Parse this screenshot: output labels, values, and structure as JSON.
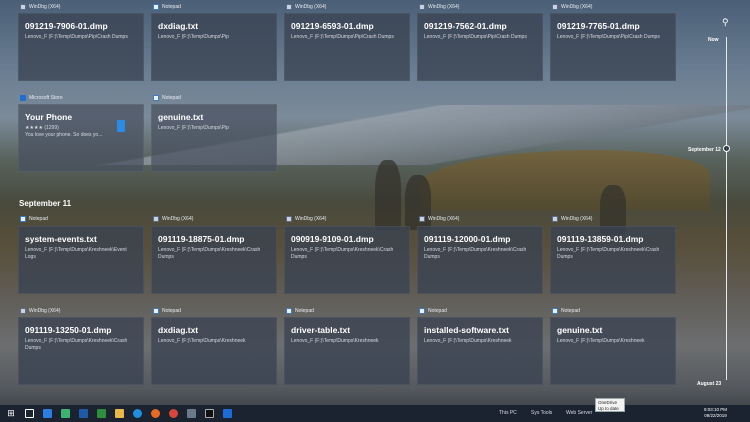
{
  "row1": [
    {
      "app": "WinDbg (X64)",
      "icon": "windbg-icon",
      "title": "091219-7906-01.dmp",
      "path": "Lenovo_F (F:)\\Temp\\Dumps\\Pip\\Crash Dumps"
    },
    {
      "app": "Notepad",
      "icon": "notepad-icon",
      "title": "dxdiag.txt",
      "path": "Lenovo_F (F:)\\Temp\\Dumps\\Pip"
    },
    {
      "app": "WinDbg (X64)",
      "icon": "windbg-icon",
      "title": "091219-6593-01.dmp",
      "path": "Lenovo_F (F:)\\Temp\\Dumps\\Pip\\Crash Dumps"
    },
    {
      "app": "WinDbg (X64)",
      "icon": "windbg-icon",
      "title": "091219-7562-01.dmp",
      "path": "Lenovo_F (F:)\\Temp\\Dumps\\Pip\\Crash Dumps"
    },
    {
      "app": "WinDbg (X64)",
      "icon": "windbg-icon",
      "title": "091219-7765-01.dmp",
      "path": "Lenovo_F (F:)\\Temp\\Dumps\\Pip\\Crash Dumps"
    }
  ],
  "row2": [
    {
      "app": "Microsoft Store",
      "icon": "store-icon",
      "title": "Your Phone",
      "path": "★★★★ (1299)\nYou love your phone. So does yo..."
    },
    {
      "app": "Notepad",
      "icon": "notepad-icon",
      "title": "genuine.txt",
      "path": "Lenovo_F (F:)\\Temp\\Dumps\\Pip"
    }
  ],
  "section_label": "September 11",
  "row3": [
    {
      "app": "Notepad",
      "icon": "notepad-icon",
      "title": "system-events.txt",
      "path": "Lenovo_F (F:)\\Temp\\Dumps\\Kreshneek\\Event Logs"
    },
    {
      "app": "WinDbg (X64)",
      "icon": "windbg-icon",
      "title": "091119-18875-01.dmp",
      "path": "Lenovo_F (F:)\\Temp\\Dumps\\Kreshneek\\Crash Dumps"
    },
    {
      "app": "WinDbg (X64)",
      "icon": "windbg-icon",
      "title": "090919-9109-01.dmp",
      "path": "Lenovo_F (F:)\\Temp\\Dumps\\Kreshneek\\Crash Dumps"
    },
    {
      "app": "WinDbg (X64)",
      "icon": "windbg-icon",
      "title": "091119-12000-01.dmp",
      "path": "Lenovo_F (F:)\\Temp\\Dumps\\Kreshneek\\Crash Dumps"
    },
    {
      "app": "WinDbg (X64)",
      "icon": "windbg-icon",
      "title": "091119-13859-01.dmp",
      "path": "Lenovo_F (F:)\\Temp\\Dumps\\Kreshneek\\Crash Dumps"
    }
  ],
  "row4": [
    {
      "app": "WinDbg (X64)",
      "icon": "windbg-icon",
      "title": "091119-13250-01.dmp",
      "path": "Lenovo_F (F:)\\Temp\\Dumps\\Kreshneek\\Crash Dumps"
    },
    {
      "app": "Notepad",
      "icon": "notepad-icon",
      "title": "dxdiag.txt",
      "path": "Lenovo_F (F:)\\Temp\\Dumps\\Kreshneek"
    },
    {
      "app": "Notepad",
      "icon": "notepad-icon",
      "title": "driver-table.txt",
      "path": "Lenovo_F (F:)\\Temp\\Dumps\\Kreshneek"
    },
    {
      "app": "Notepad",
      "icon": "notepad-icon",
      "title": "installed-software.txt",
      "path": "Lenovo_F (F:)\\Temp\\Dumps\\Kreshneek"
    },
    {
      "app": "Notepad",
      "icon": "notepad-icon",
      "title": "genuine.txt",
      "path": "Lenovo_F (F:)\\Temp\\Dumps\\Kreshneek"
    }
  ],
  "timeline": {
    "now": "Now",
    "mid": "September 12",
    "end": "August 23"
  },
  "taskbar": {
    "labels": [
      "This PC",
      "Sys Tools",
      "Web Server"
    ],
    "tooltip_title": "OneDrive",
    "tooltip_text": "Up to date",
    "time": "9:03:10 PM",
    "date": "09/22/2019"
  }
}
